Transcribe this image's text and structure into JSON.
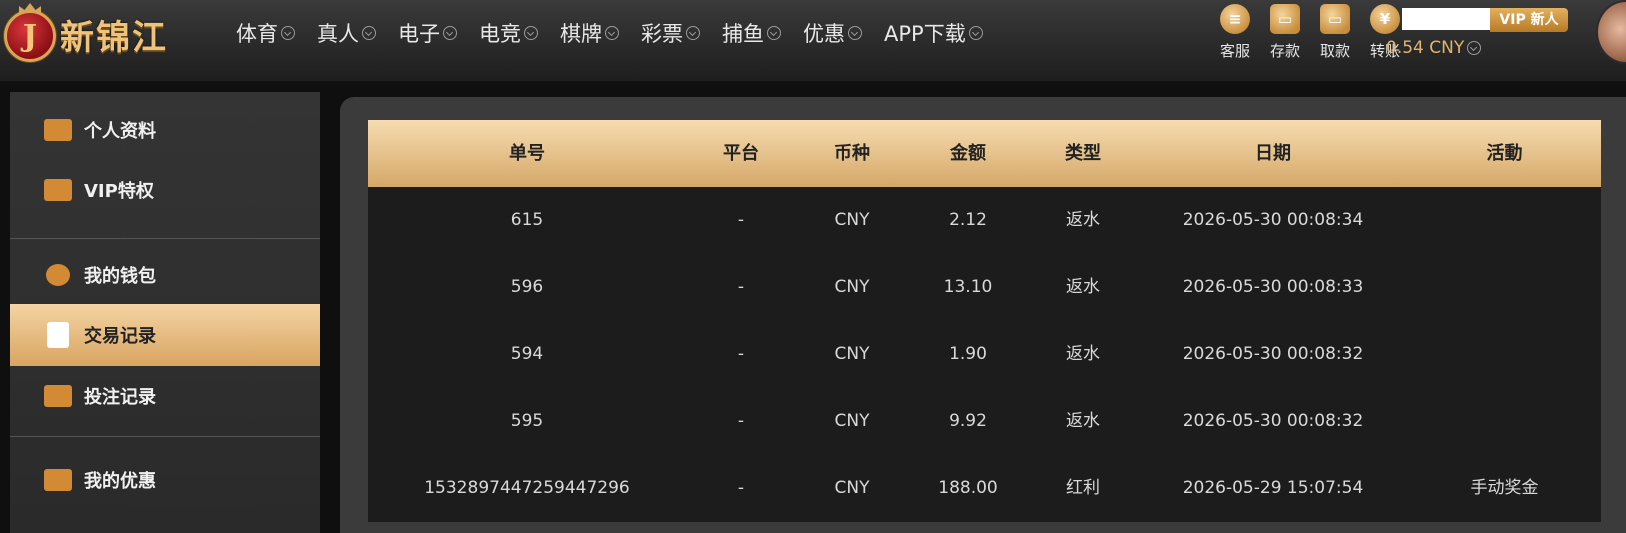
{
  "brand": {
    "logo_letter": "J",
    "logo_text": "新锦江"
  },
  "nav": [
    {
      "label": "体育"
    },
    {
      "label": "真人"
    },
    {
      "label": "电子"
    },
    {
      "label": "电竞"
    },
    {
      "label": "棋牌"
    },
    {
      "label": "彩票"
    },
    {
      "label": "捕鱼"
    },
    {
      "label": "优惠"
    },
    {
      "label": "APP下载"
    }
  ],
  "actions": [
    {
      "label": "客服",
      "icon": "chat-icon",
      "glyph": "≡"
    },
    {
      "label": "存款",
      "icon": "wallet-icon",
      "glyph": "▭"
    },
    {
      "label": "取款",
      "icon": "withdraw-icon",
      "glyph": "▭"
    },
    {
      "label": "转账",
      "icon": "yen-coin-icon",
      "glyph": "¥"
    }
  ],
  "account": {
    "vip_label": "VIP 新人",
    "balance": "0.54 CNY"
  },
  "sidebar": {
    "items": [
      {
        "label": "个人资料",
        "icon": "id-card-icon"
      },
      {
        "label": "VIP特权",
        "icon": "vip-card-icon"
      },
      {
        "label": "我的钱包",
        "icon": "piggy-bank-icon"
      },
      {
        "label": "交易记录",
        "icon": "document-icon"
      },
      {
        "label": "投注记录",
        "icon": "clipboard-icon"
      },
      {
        "label": "我的优惠",
        "icon": "gift-bag-icon"
      }
    ],
    "active": "交易记录"
  },
  "table": {
    "headers": [
      "单号",
      "平台",
      "币种",
      "金额",
      "类型",
      "日期",
      "活動"
    ],
    "rows": [
      [
        "615",
        "-",
        "CNY",
        "2.12",
        "返水",
        "2026-05-30 00:08:34",
        ""
      ],
      [
        "596",
        "-",
        "CNY",
        "13.10",
        "返水",
        "2026-05-30 00:08:33",
        ""
      ],
      [
        "594",
        "-",
        "CNY",
        "1.90",
        "返水",
        "2026-05-30 00:08:32",
        ""
      ],
      [
        "595",
        "-",
        "CNY",
        "9.92",
        "返水",
        "2026-05-30 00:08:32",
        ""
      ],
      [
        "1532897447259447296",
        "-",
        "CNY",
        "188.00",
        "红利",
        "2026-05-29 15:07:54",
        "手动奖金"
      ]
    ]
  },
  "colors": {
    "accent": "#d9a461",
    "header_gold": "#f6dcb1",
    "balance": "#e2b56d"
  }
}
